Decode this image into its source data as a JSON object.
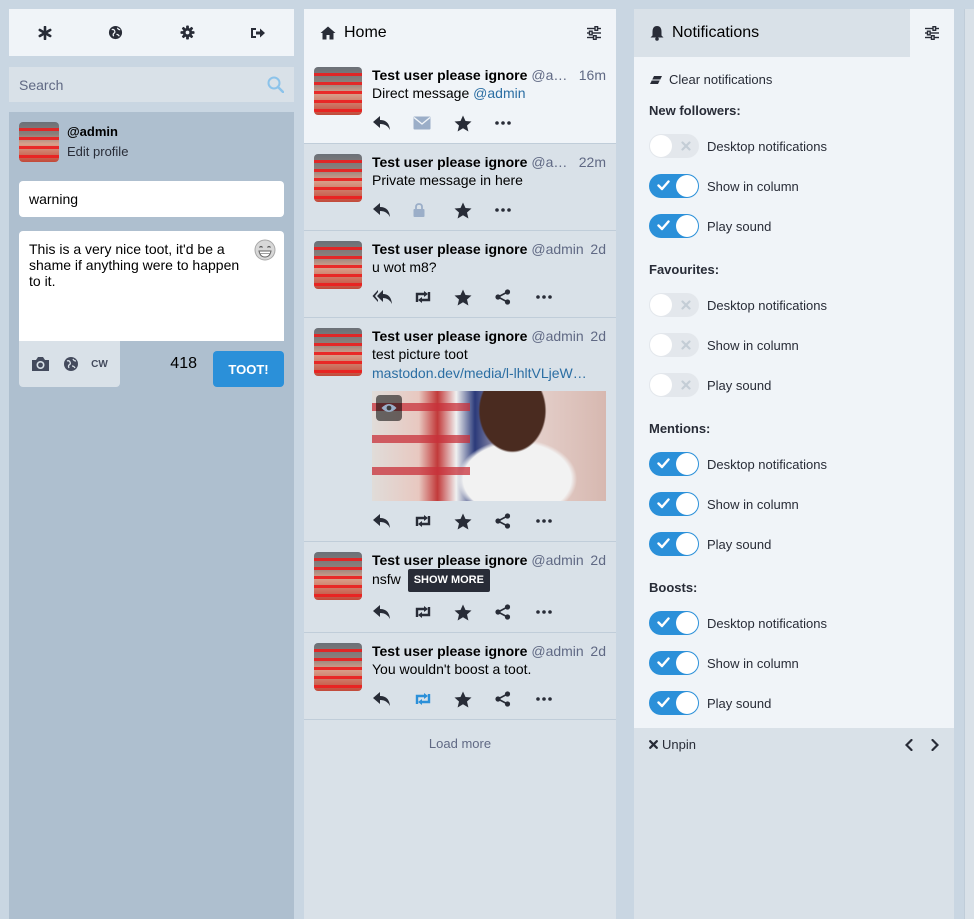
{
  "drawer": {
    "search_placeholder": "Search",
    "profile": {
      "handle": "@admin",
      "edit_label": "Edit profile"
    },
    "compose": {
      "cw_value": "warning",
      "text": "This is a very nice toot, it'd be a shame if anything were to happen to it.",
      "cw_toggle": "CW",
      "char_count": "418",
      "submit_label": "TOOT!"
    }
  },
  "home": {
    "title": "Home",
    "statuses": [
      {
        "name": "Test user please ignore",
        "acct": "@admin",
        "time": "16m",
        "text": "Direct message ",
        "mention": "@admin"
      },
      {
        "name": "Test user please ignore",
        "acct": "@admin",
        "time": "22m",
        "text": "Private message in here"
      },
      {
        "name": "Test user please ignore",
        "acct": "@admin",
        "time": "2d",
        "text": "u wot m8?"
      },
      {
        "name": "Test user please ignore",
        "acct": "@admin",
        "time": "2d",
        "text": "test picture toot",
        "url": "mastodon.dev/media/l-lhltVLjeW…"
      },
      {
        "name": "Test user please ignore",
        "acct": "@admin",
        "time": "2d",
        "text": "nsfw",
        "show_more": "SHOW MORE"
      },
      {
        "name": "Test user please ignore",
        "acct": "@admin",
        "time": "2d",
        "text": "You wouldn't boost a toot."
      }
    ],
    "load_more": "Load more"
  },
  "notifications": {
    "title": "Notifications",
    "clear_label": "Clear notifications",
    "sections": [
      {
        "title": "New followers:",
        "items": [
          {
            "label": "Desktop notifications",
            "on": false
          },
          {
            "label": "Show in column",
            "on": true
          },
          {
            "label": "Play sound",
            "on": true
          }
        ]
      },
      {
        "title": "Favourites:",
        "items": [
          {
            "label": "Desktop notifications",
            "on": false
          },
          {
            "label": "Show in column",
            "on": false
          },
          {
            "label": "Play sound",
            "on": false
          }
        ]
      },
      {
        "title": "Mentions:",
        "items": [
          {
            "label": "Desktop notifications",
            "on": true
          },
          {
            "label": "Show in column",
            "on": true
          },
          {
            "label": "Play sound",
            "on": true
          }
        ]
      },
      {
        "title": "Boosts:",
        "items": [
          {
            "label": "Desktop notifications",
            "on": true
          },
          {
            "label": "Show in column",
            "on": true
          },
          {
            "label": "Play sound",
            "on": true
          }
        ]
      }
    ],
    "unpin_label": "Unpin"
  },
  "colors": {
    "accent": "#2b90d9",
    "ui_bg": "#d9e1e8",
    "panel": "#f0f4f8",
    "drawer": "#aebfcf",
    "page": "#c9d6e2",
    "muted": "#606984"
  },
  "icons": {
    "header": [
      "asterisk-icon",
      "globe-icon",
      "gear-icon",
      "sign-out-icon"
    ],
    "status_actions": [
      "reply-icon",
      "boost-icon",
      "star-icon",
      "share-icon",
      "ellipsis-icon"
    ]
  }
}
